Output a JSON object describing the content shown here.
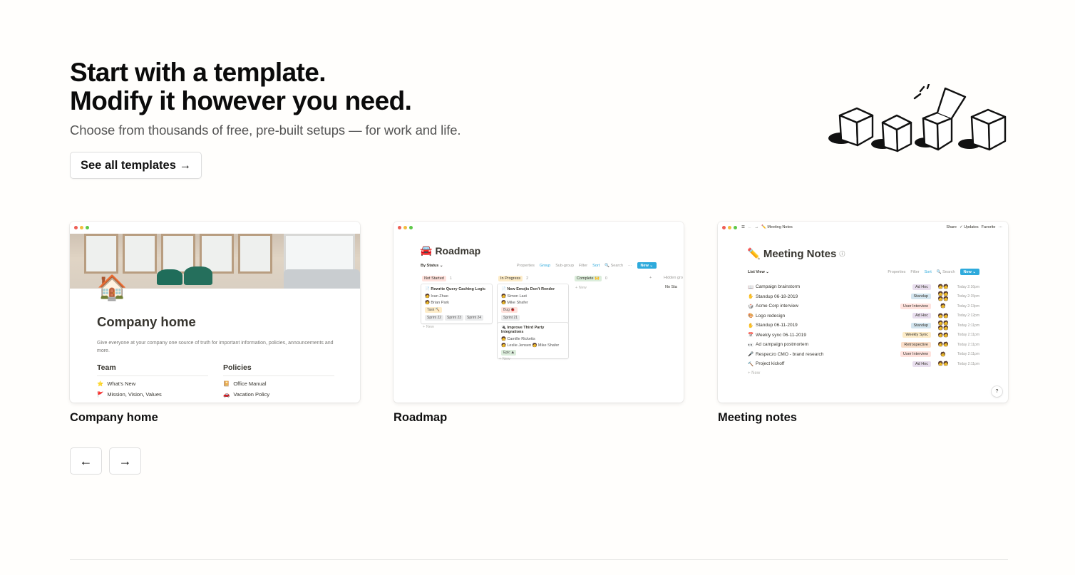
{
  "hero": {
    "title_line1": "Start with a template.",
    "title_line2": "Modify it however you need.",
    "subtitle": "Choose from thousands of free, pre-built setups — for work and life.",
    "cta_label": "See all templates →"
  },
  "templates": [
    {
      "label": "Company home",
      "preview": {
        "icon": "🏠",
        "title": "Company home",
        "description": "Give everyone at your company one source of truth for important information, policies, announcements and more.",
        "columns": [
          {
            "heading": "Team",
            "items": [
              {
                "icon": "⭐",
                "text": "What's New"
              },
              {
                "icon": "🚩",
                "text": "Mission, Vision, Values"
              }
            ]
          },
          {
            "heading": "Policies",
            "items": [
              {
                "icon": "📔",
                "text": "Office Manual"
              },
              {
                "icon": "🚗",
                "text": "Vacation Policy"
              }
            ]
          }
        ]
      }
    },
    {
      "label": "Roadmap",
      "preview": {
        "icon": "🚘",
        "title": "Roadmap",
        "view": "By Status ⌄",
        "tools": [
          "Properties",
          "Group",
          "Sub-group",
          "Filter",
          "Sort",
          "🔍 Search",
          "···"
        ],
        "new_label": "New ⌄",
        "lanes": [
          {
            "name": "Not Started",
            "count": "1",
            "color": "#ffe2dd"
          },
          {
            "name": "In Progress",
            "count": "2",
            "color": "#fdecc8"
          },
          {
            "name": "Complete 🙌",
            "count": "0",
            "color": "#dbeddb"
          }
        ],
        "add_group": "+",
        "hidden_groups": "Hidden gro",
        "no_status": "No Sta",
        "cards": [
          {
            "title": "📄 Rewrite Query Caching Logic",
            "people": [
              "🧑 Ivan Zhao",
              "🧑 Brian Park"
            ],
            "tags": [
              "Task 🔨"
            ],
            "sprints": [
              "Sprint 22",
              "Sprint 23",
              "Sprint 24"
            ]
          },
          {
            "title": "📄 New Emojis Don't Render",
            "people": [
              "🧑 Simon Last",
              "🧑 Mike Shafer"
            ],
            "tags": [
              "Bug 🐞"
            ],
            "sprints": [
              "Sprint 21"
            ]
          },
          {
            "title": "🔌 Improve Third Party Integrations",
            "people": [
              "🧑 Camille Ricketts",
              "🧑 Leslie Jensen  🧑 Mike Shafer"
            ],
            "tags": [
              "Epic ⛰"
            ],
            "sprints": []
          }
        ],
        "new_text": "+ New"
      }
    },
    {
      "label": "Meeting notes",
      "preview": {
        "breadcrumb": "✏️ Meeting Notes",
        "top_actions": [
          "Share",
          "✓ Updates",
          "Favorite",
          "···"
        ],
        "title": "✏️ Meeting Notes",
        "view": "List View ⌄",
        "tools": [
          "Properties",
          "Filter",
          "Sort",
          "🔍 Search"
        ],
        "new_label": "New ⌄",
        "rows": [
          {
            "icon": "📖",
            "name": "Campaign brainstorm",
            "tag": "Ad Hoc",
            "tag_color": "#e8deee",
            "avatars": "🧑🧑",
            "time": "Today 2:16pm"
          },
          {
            "icon": "✋",
            "name": "Standup 06-18-2019",
            "tag": "Standup",
            "tag_color": "#d3e5ef",
            "avatars": "🧑🧑🧑🧑",
            "time": "Today 2:15pm"
          },
          {
            "icon": "🎲",
            "name": "Acme Corp interview",
            "tag": "User Interview",
            "tag_color": "#ffe2dd",
            "avatars": "🧑",
            "time": "Today 2:13pm"
          },
          {
            "icon": "🎨",
            "name": "Logo redesign",
            "tag": "Ad Hoc",
            "tag_color": "#e8deee",
            "avatars": "🧑🧑",
            "time": "Today 2:12pm"
          },
          {
            "icon": "✋",
            "name": "Standup 06-11-2019",
            "tag": "Standup",
            "tag_color": "#d3e5ef",
            "avatars": "🧑🧑🧑🧑",
            "time": "Today 2:11pm"
          },
          {
            "icon": "📅",
            "name": "Weekly sync 06-11-2019",
            "tag": "Weekly Sync",
            "tag_color": "#fdecc8",
            "avatars": "🧑🧑",
            "time": "Today 2:11pm"
          },
          {
            "icon": "👀",
            "name": "Ad campaign postmortem",
            "tag": "Retrospective",
            "tag_color": "#fadec9",
            "avatars": "🧑🧑",
            "time": "Today 2:11pm"
          },
          {
            "icon": "🎤",
            "name": "Respeczo CMO - brand research",
            "tag": "User Interview",
            "tag_color": "#ffe2dd",
            "avatars": "🧑",
            "time": "Today 2:11pm"
          },
          {
            "icon": "🔨",
            "name": "Project kickoff",
            "tag": "Ad Hoc",
            "tag_color": "#e8deee",
            "avatars": "🧑🧑",
            "time": "Today 2:11pm"
          }
        ],
        "new_text": "+ New",
        "help": "?"
      }
    }
  ],
  "carousel": {
    "prev_icon": "arrow-left-icon",
    "next_icon": "arrow-right-icon",
    "prev_glyph": "←",
    "next_glyph": "→"
  }
}
